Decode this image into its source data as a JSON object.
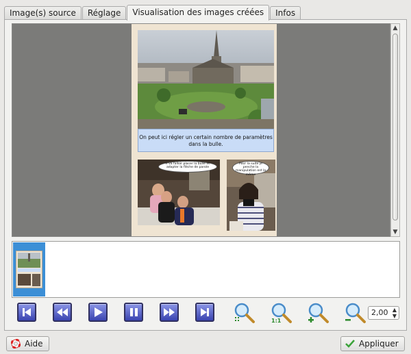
{
  "tabs": [
    {
      "label": "Image(s) source"
    },
    {
      "label": "Réglage"
    },
    {
      "label": "Visualisation des images créées"
    },
    {
      "label": "Infos"
    }
  ],
  "active_tab": 2,
  "preview": {
    "caption": "On peut ici régler un certain nombre de paramètres dans la bulle.",
    "bubble_left": "Il va falloir placer la bulle et adapter la flèche de parole",
    "bubble_right": "Pour la suite je penche la manipulation est la même"
  },
  "zoom": {
    "value": "2,00"
  },
  "icons": {
    "first": "skip-first-icon",
    "prev": "rewind-icon",
    "play": "play-icon",
    "pause": "pause-icon",
    "next": "fast-forward-icon",
    "last": "skip-last-icon",
    "zoom_fit": "zoom-fit-icon",
    "zoom_orig": "zoom-original-icon",
    "zoom_in": "zoom-in-icon",
    "zoom_out": "zoom-out-icon",
    "help": "lifebuoy-icon",
    "apply": "checkmark-icon"
  },
  "colors": {
    "nav_button": "#3a44b0",
    "caption_bg": "#c9dcf7",
    "selection": "#3c8fd6",
    "preview_bg": "#7b7b79"
  },
  "buttons": {
    "help": "Aide",
    "apply": "Appliquer"
  }
}
